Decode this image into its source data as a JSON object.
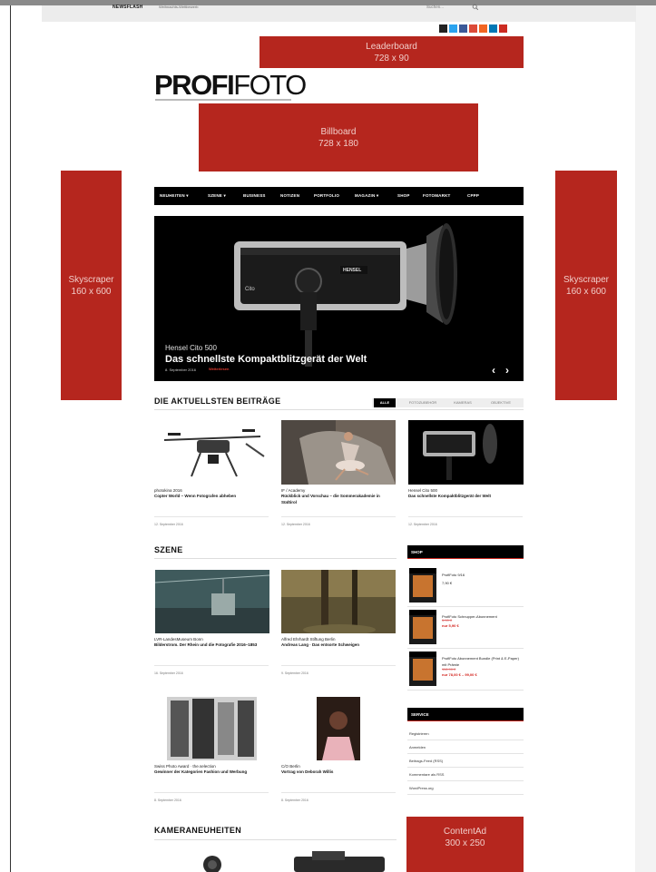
{
  "topbar": {
    "newsflash_label": "NEWSFLASH",
    "newsflash_text": "Weihnachts-Wettbewerb",
    "search_placeholder": "Suchen..."
  },
  "social": [
    {
      "icon": "instagram-icon",
      "color": "#222222"
    },
    {
      "icon": "twitter-icon",
      "color": "#2aa3ef"
    },
    {
      "icon": "facebook-icon",
      "color": "#3b5998"
    },
    {
      "icon": "google-plus-icon",
      "color": "#dc4a38"
    },
    {
      "icon": "rss-icon",
      "color": "#f26522"
    },
    {
      "icon": "linkedin-icon",
      "color": "#0077b5"
    },
    {
      "icon": "youtube-icon",
      "color": "#cc2b22"
    }
  ],
  "ads": {
    "leaderboard": {
      "name": "Leaderboard",
      "size": "728 x 90"
    },
    "billboard": {
      "name": "Billboard",
      "size": "728 x 180"
    },
    "skyscraper_left": {
      "name": "Skyscraper",
      "size": "160 x 600"
    },
    "skyscraper_right": {
      "name": "Skyscraper",
      "size": "160 x 600"
    },
    "content_ad": {
      "name": "ContentAd",
      "size": "300 x 250"
    }
  },
  "logo": {
    "bold": "PROFI",
    "light": "FOTO"
  },
  "nav": [
    {
      "label": "NEUHEITEN",
      "dropdown": true
    },
    {
      "label": "SZENE",
      "dropdown": true
    },
    {
      "label": "BUSINESS",
      "dropdown": false
    },
    {
      "label": "NOTIZEN",
      "dropdown": false
    },
    {
      "label": "PORTFOLIO",
      "dropdown": false
    },
    {
      "label": "MAGAZIN",
      "dropdown": true
    },
    {
      "label": "SHOP",
      "dropdown": false
    },
    {
      "label": "FOTOMARKT",
      "dropdown": false
    },
    {
      "label": "CPPP",
      "dropdown": false
    }
  ],
  "hero": {
    "brand": "Hensel Cito 500",
    "title": "Das schnellste Kompaktblitzgerät der Welt",
    "date": "8. September 2016",
    "more": "Weiterlesen",
    "device_brand": "HENSEL",
    "device_model": "Cito"
  },
  "latest": {
    "title": "DIE AKTUELLSTEN BEITRÄGE",
    "tabs": [
      "ALLE",
      "FOTOZUBEHÖR",
      "KAMERAS",
      "OBJEKTIVE"
    ],
    "active_tab": 0,
    "cards": [
      {
        "category": "photokina 2016",
        "title": "Copter World – Wenn Fotografen abheben",
        "date": "12. September 2016"
      },
      {
        "category": "IF / Academy",
        "title": "Rückblick und Vorschau – die Sommerakademie in Südtirol",
        "date": "12. September 2016"
      },
      {
        "category": "Hensel Cito 500",
        "title": "Das schnellste Kompaktblitzgerät der Welt",
        "date": "12. September 2016"
      }
    ]
  },
  "szene": {
    "title": "SZENE",
    "cards": [
      {
        "category": "LVR-LandesMuseum Bonn",
        "title": "Bilderstrom. Der Rhein und die Fotografie 2016–1853",
        "date": "16. September 2016"
      },
      {
        "category": "Alfred Ehrhardt Stiftung Berlin",
        "title": "Andreas Lang · Das entsorte Schweigen",
        "date": "9. September 2016"
      },
      {
        "category": "Swiss Photo Award · the.selection",
        "title": "Gewinner der Kategorien Fashion und Werbung",
        "date": "8. September 2016"
      },
      {
        "category": "C/O Berlin",
        "title": "Vortrag von Deborah Willis",
        "date": "8. September 2016"
      }
    ]
  },
  "kameras": {
    "title": "KAMERANEUHEITEN"
  },
  "shop": {
    "title": "SHOP",
    "items": [
      {
        "name": "ProfiFoto 9/16",
        "price": "7,90 €",
        "old_price": "",
        "new_price": ""
      },
      {
        "name": "ProfiFoto Schnupper-Abonnement",
        "price": "",
        "old_price": "~~5,90 €~~",
        "new_price": "nur 5,90 €"
      },
      {
        "name": "ProfiFoto Abonnement Bundle (Print & E-Paper) mit Prämie",
        "price": "",
        "old_price": "~~118,90 €~~",
        "new_price": "nur 78,00 € – 99,00 €"
      }
    ]
  },
  "service": {
    "title": "SERVICE",
    "links": [
      "Registrieren",
      "Anmelden",
      "Beitrags-Feed (RSS)",
      "Kommentare als RSS",
      "WordPress.org"
    ]
  }
}
